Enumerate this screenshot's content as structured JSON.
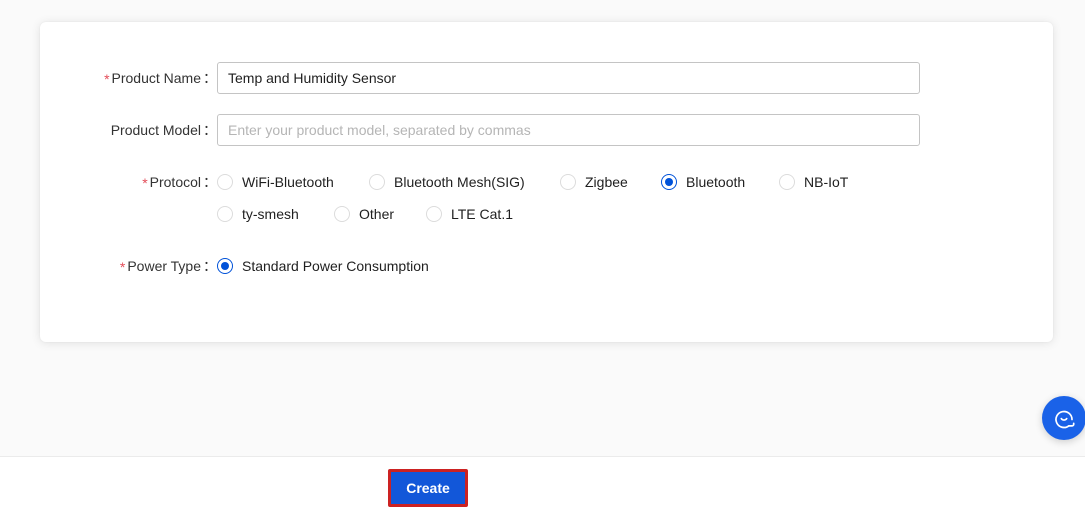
{
  "form": {
    "fields": [
      {
        "id": "product-name",
        "label": "Product Name",
        "colon": "：",
        "required": true,
        "type": "text",
        "value": "Temp and Humidity Sensor",
        "placeholder": ""
      },
      {
        "id": "product-model",
        "label": "Product Model",
        "colon": "：",
        "required": false,
        "type": "text",
        "value": "",
        "placeholder": "Enter your product model, separated by commas"
      },
      {
        "id": "protocol",
        "label": "Protocol",
        "colon": "：",
        "required": true,
        "type": "radio",
        "selected": "Bluetooth",
        "options": [
          "WiFi-Bluetooth",
          "Bluetooth Mesh(SIG)",
          "Zigbee",
          "Bluetooth",
          "NB-IoT",
          "ty-smesh",
          "Other",
          "LTE Cat.1"
        ]
      },
      {
        "id": "power-type",
        "label": "Power Type",
        "colon": "：",
        "required": true,
        "type": "radio",
        "selected": "Standard Power Consumption",
        "options": [
          "Standard Power Consumption"
        ]
      }
    ]
  },
  "footer": {
    "create_label": "Create"
  },
  "widgets": {
    "chat_icon": "headset-chat-icon"
  },
  "colors": {
    "accent": "#0052d9",
    "button": "#1257d9",
    "highlight_border": "#cc2222",
    "required_star": "#e34d59",
    "page_bg": "#fafafa",
    "card_bg": "#ffffff"
  }
}
